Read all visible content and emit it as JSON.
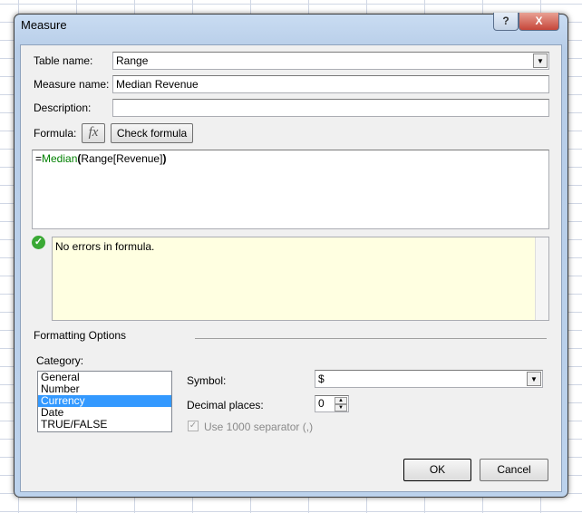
{
  "dialog": {
    "title": "Measure",
    "help_label": "?",
    "close_label": "X"
  },
  "form": {
    "table_name_label": "Table name:",
    "table_name_value": "Range",
    "measure_name_label": "Measure name:",
    "measure_name_value": "Median Revenue",
    "description_label": "Description:",
    "description_value": "",
    "formula_label": "Formula:",
    "fx_label": "fx",
    "check_formula_label": "Check formula",
    "formula": {
      "prefix": "=",
      "function": "Median",
      "open": "(",
      "argument": "Range[Revenue]",
      "close": ")"
    },
    "status_message": "No errors in formula."
  },
  "formatting": {
    "heading": "Formatting Options",
    "category_label": "Category:",
    "categories": [
      "General",
      "Number",
      "Currency",
      "Date",
      "TRUE/FALSE"
    ],
    "selected_category": "Currency",
    "symbol_label": "Symbol:",
    "symbol_value": "$",
    "decimal_label": "Decimal places:",
    "decimal_value": "0",
    "separator_label": "Use 1000 separator (,)",
    "separator_checked": true
  },
  "buttons": {
    "ok": "OK",
    "cancel": "Cancel"
  },
  "colors": {
    "function": "#008000",
    "status_bg": "#ffffe1",
    "selection": "#3399ff",
    "success": "#3aa935"
  }
}
